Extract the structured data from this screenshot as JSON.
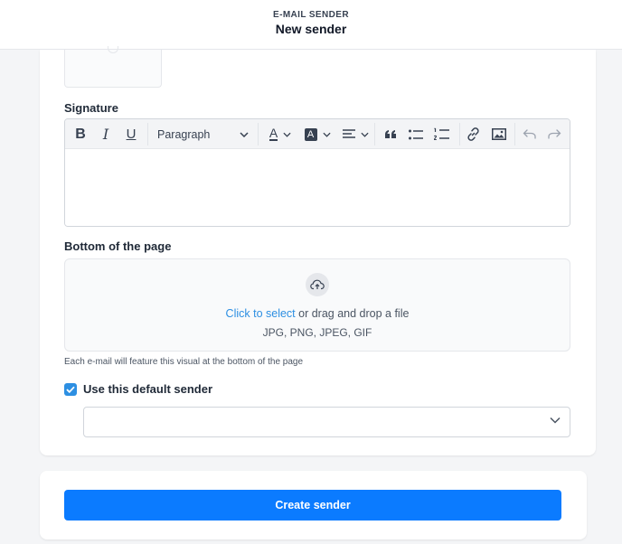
{
  "header": {
    "eyebrow": "E-MAIL SENDER",
    "title": "New sender"
  },
  "signature": {
    "label": "Signature",
    "toolbar": {
      "bold_label": "B",
      "italic_label": "I",
      "underline_label": "U",
      "format_value": "Paragraph",
      "text_color_label": "A",
      "highlight_label": "A",
      "icons": [
        "bold-icon",
        "italic-icon",
        "underline-icon",
        "chevron-down-icon",
        "font-color-icon",
        "highlight-icon",
        "align-icon",
        "quote-icon",
        "bullet-list-icon",
        "numbered-list-icon",
        "link-icon",
        "image-icon",
        "undo-icon",
        "redo-icon"
      ]
    },
    "content": ""
  },
  "bottom": {
    "label": "Bottom of the page",
    "upload_link": "Click to select",
    "upload_text": " or drag and drop a file",
    "formats": "JPG, PNG, JPEG, GIF",
    "hint": "Each e-mail will feature this visual at the bottom of the page"
  },
  "default_sender": {
    "label": "Use this default sender",
    "checked": true,
    "select_value": ""
  },
  "actions": {
    "create_label": "Create sender"
  },
  "colors": {
    "primary": "#0b7bff",
    "link": "#2d8fe2",
    "border": "#d1d5db",
    "toolbar_bg": "#f3f4f6",
    "page_bg": "#f4f5f7"
  }
}
